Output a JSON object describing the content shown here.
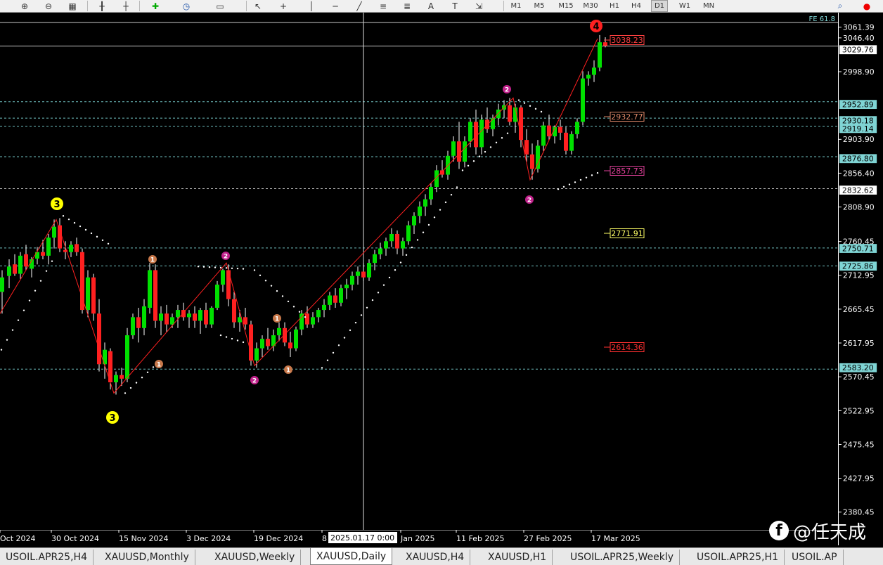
{
  "window": {
    "symbol": "XAUUSD",
    "timeframe": "Daily"
  },
  "toolbar": {
    "timeframes": [
      "M1",
      "M5",
      "M15",
      "M30",
      "H1",
      "H4",
      "D1",
      "W1",
      "MN"
    ],
    "active_timeframe": "D1",
    "icons": [
      "zoom-in-icon",
      "zoom-out-icon",
      "tile-windows-icon",
      "period-separator-icon",
      "object-list-icon",
      "new-indicator-icon",
      "clock-icon",
      "template-icon",
      "cursor-icon",
      "crosshair-icon",
      "vertical-line-icon",
      "horizontal-line-icon",
      "trendline-icon",
      "fibonacci-icon",
      "fibonacci-expansion-icon",
      "text-icon",
      "text-label-icon",
      "arrows-icon",
      "search-icon",
      "alert-icon"
    ]
  },
  "chart": {
    "fe_label": "FE 61.8",
    "crosshair_date": "2025.01.17 0:00",
    "price_scale": [
      "3061.39",
      "3046.40",
      "2998.90",
      "2903.90",
      "2856.40",
      "2808.90",
      "2760.45",
      "2712.95",
      "2665.45",
      "2617.95",
      "2570.45",
      "2522.95",
      "2475.45",
      "2427.95",
      "2380.45"
    ],
    "hline_labels": [
      {
        "value": "3029.76",
        "color": "#ffffff",
        "style": "solid"
      },
      {
        "value": "2952.89",
        "color": "#7fd4d4",
        "style": "dashed"
      },
      {
        "value": "2930.18",
        "color": "#7fd4d4",
        "style": "dashed"
      },
      {
        "value": "2919.14",
        "color": "#7fd4d4",
        "style": "dashed"
      },
      {
        "value": "2876.80",
        "color": "#7fd4d4",
        "style": "dashed"
      },
      {
        "value": "2832.62",
        "color": "#ffffff",
        "style": "dashed"
      },
      {
        "value": "2750.71",
        "color": "#7fd4d4",
        "style": "dashed"
      },
      {
        "value": "2725.86",
        "color": "#7fd4d4",
        "style": "dashed"
      },
      {
        "value": "2583.20",
        "color": "#7fd4d4",
        "style": "dashed"
      }
    ],
    "level_labels": [
      {
        "text": "3038.23",
        "color": "#ff4040"
      },
      {
        "text": "2932.77",
        "color": "#e08a6a"
      },
      {
        "text": "2857.73",
        "color": "#e0409a"
      },
      {
        "text": "2771.91",
        "color": "#ffff66"
      },
      {
        "text": "2614.36",
        "color": "#ff3030"
      }
    ],
    "wave_labels": [
      {
        "text": "3",
        "color": "#ffff00",
        "fg": "#000000",
        "big": true
      },
      {
        "text": "3",
        "color": "#ffff00",
        "fg": "#000000",
        "big": true
      },
      {
        "text": "4",
        "color": "#ff2020",
        "fg": "#000000",
        "big": true
      },
      {
        "text": "1",
        "color": "#c8784a",
        "fg": "#ffffff",
        "big": false
      },
      {
        "text": "1",
        "color": "#c8784a",
        "fg": "#ffffff",
        "big": false
      },
      {
        "text": "1",
        "color": "#c8784a",
        "fg": "#ffffff",
        "big": false
      },
      {
        "text": "1",
        "color": "#c8784a",
        "fg": "#ffffff",
        "big": false
      },
      {
        "text": "2",
        "color": "#c0208a",
        "fg": "#ffffff",
        "big": false
      },
      {
        "text": "2",
        "color": "#c0208a",
        "fg": "#ffffff",
        "big": false
      },
      {
        "text": "2",
        "color": "#c0208a",
        "fg": "#ffffff",
        "big": false
      },
      {
        "text": "2",
        "color": "#c0208a",
        "fg": "#ffffff",
        "big": false
      }
    ],
    "date_labels": [
      "Oct 2024",
      "30 Oct 2024",
      "15 Nov 2024",
      "3 Dec 2024",
      "19 Dec 2024",
      "8",
      "Jan 2025",
      "11 Feb 2025",
      "27 Feb 2025",
      "17 Mar 2025"
    ],
    "colors": {
      "bull": "#00e000",
      "bear": "#ff2020",
      "wick": "#ffffff",
      "zigzag": "#ff2020",
      "sar": "#ffffff",
      "background": "#000000"
    }
  },
  "tabs": [
    "USOIL.APR25,H4",
    "XAUUSD,Monthly",
    "XAUUSD,Weekly",
    "XAUUSD,Daily",
    "XAUUSD,H4",
    "XAUUSD,H1",
    "USOIL.APR25,Weekly",
    "USOIL.APR25,H1",
    "USOIL.AP"
  ],
  "active_tab": "XAUUSD,Daily",
  "watermark": "@任天成"
}
